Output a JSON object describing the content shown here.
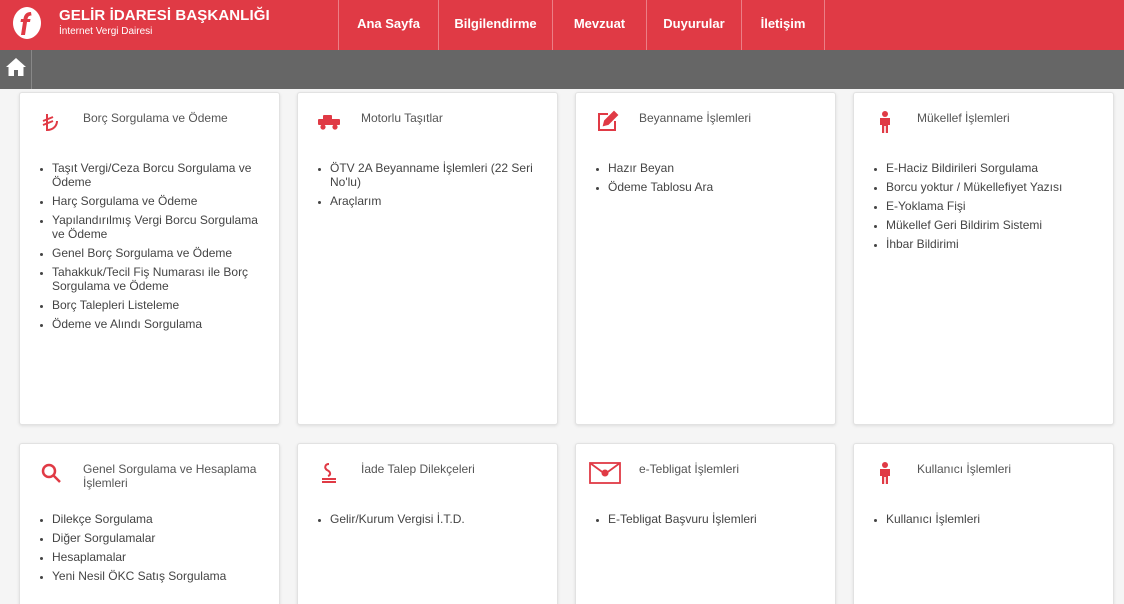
{
  "header": {
    "title": "GELİR İDARESİ BAŞKANLIĞI",
    "subtitle": "İnternet Vergi Dairesi",
    "nav": [
      "Ana Sayfa",
      "Bilgilendirme",
      "Mevzuat",
      "Duyurular",
      "İletişim"
    ]
  },
  "colors": {
    "brand": "#e03a45",
    "bar": "#666666"
  },
  "cards": [
    {
      "title": "Borç Sorgulama ve Ödeme",
      "icon": "tl-icon",
      "items": [
        "Taşıt Vergi/Ceza Borcu Sorgulama ve Ödeme",
        "Harç Sorgulama ve Ödeme",
        "Yapılandırılmış Vergi Borcu Sorgulama ve Ödeme",
        "Genel Borç Sorgulama ve Ödeme",
        "Tahakkuk/Tecil Fiş Numarası ile Borç Sorgulama ve Ödeme",
        "Borç Talepleri Listeleme",
        "Ödeme ve Alındı Sorgulama"
      ]
    },
    {
      "title": "Motorlu Taşıtlar",
      "icon": "car-icon",
      "items": [
        "ÖTV 2A Beyanname İşlemleri (22 Seri No'lu)",
        "Araçlarım"
      ]
    },
    {
      "title": "Beyanname İşlemleri",
      "icon": "edit-icon",
      "items": [
        "Hazır Beyan",
        "Ödeme Tablosu Ara"
      ]
    },
    {
      "title": "Mükellef İşlemleri",
      "icon": "person-icon",
      "items": [
        "E-Haciz Bildirileri Sorgulama",
        "Borcu yoktur / Mükellefiyet Yazısı",
        "E-Yoklama Fişi",
        "Mükellef Geri Bildirim Sistemi",
        "İhbar Bildirimi"
      ]
    },
    {
      "title": "Genel Sorgulama ve Hesaplama İşlemleri",
      "icon": "search-icon",
      "items": [
        "Dilekçe Sorgulama",
        "Diğer Sorgulamalar",
        "Hesaplamalar",
        "Yeni Nesil ÖKC Satış Sorgulama"
      ]
    },
    {
      "title": "İade Talep Dilekçeleri",
      "icon": "refund-icon",
      "items": [
        "Gelir/Kurum Vergisi İ.T.D."
      ]
    },
    {
      "title": "e-Tebligat İşlemleri",
      "icon": "envelope-icon",
      "items": [
        "E-Tebligat Başvuru İşlemleri"
      ]
    },
    {
      "title": "Kullanıcı İşlemleri",
      "icon": "person-icon",
      "items": [
        "Kullanıcı İşlemleri"
      ]
    }
  ]
}
